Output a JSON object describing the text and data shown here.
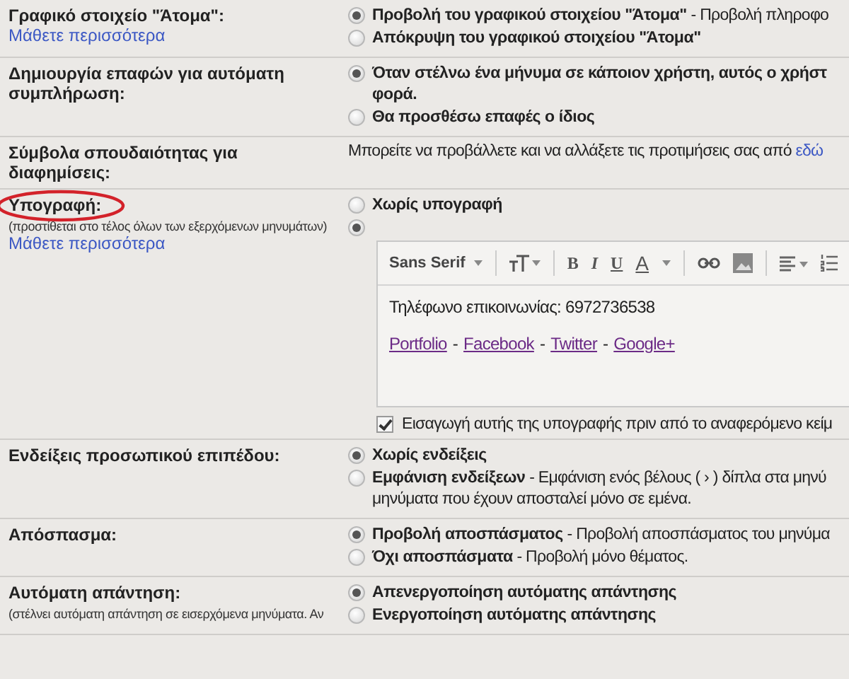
{
  "sections": [
    {
      "kind": "radios",
      "label": "Γραφικό στοιχείο \"Άτομα\":",
      "link": "Μάθετε περισσότερα",
      "options": [
        {
          "title": "Προβολή του γραφικού στοιχείου \"Άτομα\"",
          "description": "- Προβολή πληροφο",
          "selected": true
        },
        {
          "title": "Απόκρυψη του γραφικού στοιχείου \"Άτομα\"",
          "selected": false
        }
      ]
    },
    {
      "kind": "radios",
      "label": "Δημιουργία επαφών για αυτόματη συμπλήρωση:",
      "options": [
        {
          "title": "Όταν στέλνω ένα μήνυμα σε κάποιον χρήστη, αυτός ο χρήστ\nφορά.",
          "selected": true
        },
        {
          "title": "Θα προσθέσω επαφές ο ίδιος",
          "selected": false
        }
      ]
    },
    {
      "kind": "text",
      "label": "Σύμβολα σπουδαιότητας για διαφημίσεις:",
      "text": "Μπορείτε να προβάλλετε και να αλλάξετε τις προτιμήσεις σας από",
      "text_link": "εδώ"
    },
    {
      "kind": "signature",
      "label": "Υπογραφή:",
      "circled": true,
      "hint": "(προστίθεται στο τέλος όλων των εξερχόμενων μηνυμάτων)",
      "link": "Μάθετε περισσότερα",
      "options": [
        {
          "title": "Χωρίς υπογραφή",
          "selected": false
        },
        {
          "selected": true
        }
      ],
      "editor": {
        "font": "Sans Serif",
        "format_buttons": [
          "B",
          "I",
          "U",
          "A"
        ],
        "line": "Τηλέφωνο επικοινωνίας: 6972736538",
        "links": [
          "Portfolio",
          "Facebook",
          "Twitter",
          "Google+"
        ],
        "separator": "-"
      },
      "checkbox": {
        "label": "Εισαγωγή αυτής της υπογραφής πριν από το αναφερόμενο κείμ",
        "checked": true
      }
    },
    {
      "kind": "radios",
      "label": "Ενδείξεις προσωπικού επιπέδου:",
      "options": [
        {
          "title": "Χωρίς ενδείξεις",
          "selected": true
        },
        {
          "title": "Εμφάνιση ενδείξεων",
          "description": "- Εμφάνιση ενός βέλους ( › ) δίπλα στα μηνύ\nμηνύματα που έχουν αποσταλεί μόνο σε εμένα.",
          "selected": false
        }
      ]
    },
    {
      "kind": "radios",
      "label": "Απόσπασμα:",
      "options": [
        {
          "title": "Προβολή αποσπάσματος",
          "description": "- Προβολή αποσπάσματος του μηνύμα",
          "selected": true
        },
        {
          "title": "Όχι αποσπάσματα",
          "description": "- Προβολή μόνο θέματος.",
          "selected": false
        }
      ]
    },
    {
      "kind": "radios",
      "label": "Αυτόματη απάντηση:",
      "hint": "(στέλνει αυτόματη απάντηση σε εισερχόμενα μηνύματα. Αν",
      "options": [
        {
          "title": "Απενεργοποίηση αυτόματης απάντησης",
          "selected": true
        },
        {
          "title": "Ενεργοποίηση αυτόματης απάντησης",
          "selected": false
        }
      ]
    }
  ]
}
